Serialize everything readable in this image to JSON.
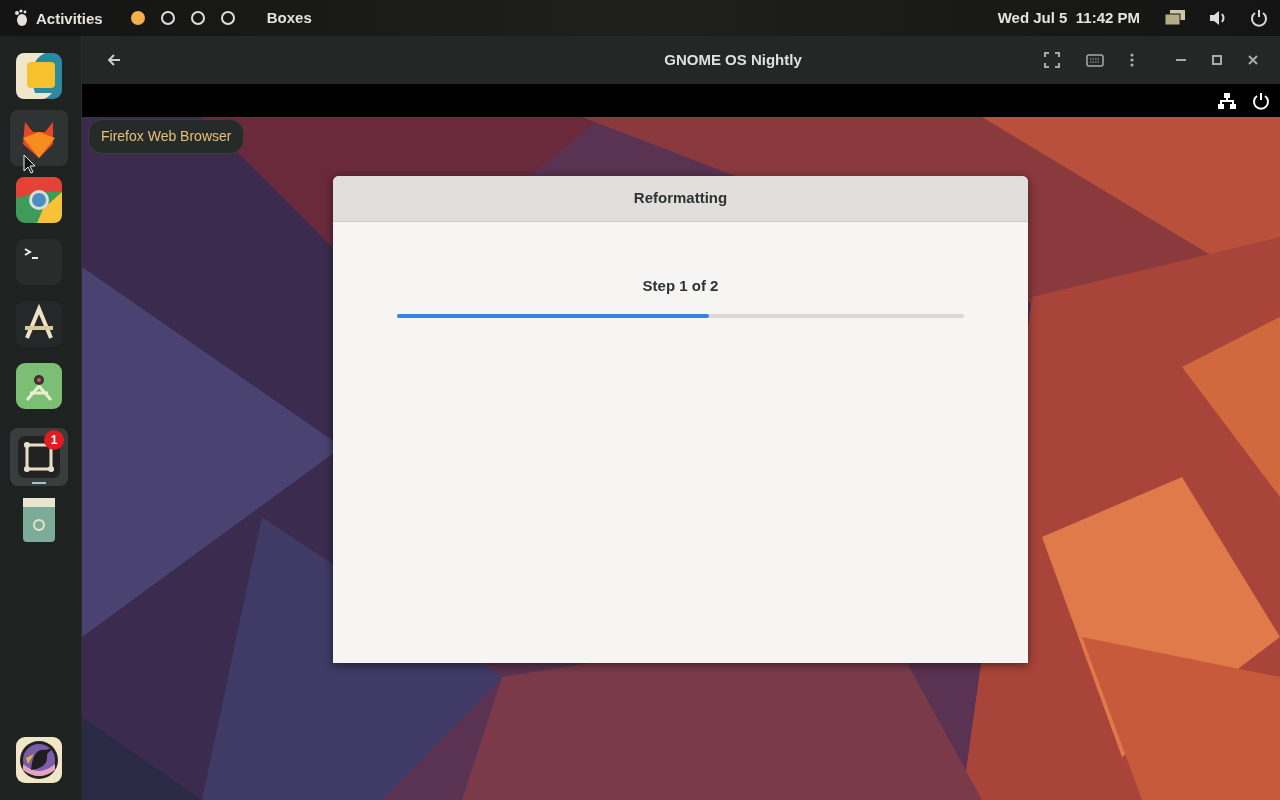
{
  "top_bar": {
    "activities": "Activities",
    "workspaces": [
      {
        "selected": true
      },
      {
        "selected": false
      },
      {
        "selected": false
      },
      {
        "selected": false
      }
    ],
    "app_name": "Boxes",
    "clock": "Wed Jul 5  11:42 PM"
  },
  "dock": {
    "items": [
      {
        "hovered": false,
        "running": false
      },
      {
        "hovered": true,
        "running": false
      },
      {
        "hovered": false,
        "running": false
      },
      {
        "hovered": false,
        "running": false
      },
      {
        "hovered": false,
        "running": false
      },
      {
        "hovered": false,
        "running": false
      },
      {
        "hovered": false,
        "running": true,
        "badge": "1"
      },
      {
        "hovered": false,
        "running": false
      },
      {
        "hovered": false,
        "running": false
      }
    ],
    "tooltip": "Firefox Web Browser"
  },
  "window": {
    "title": "GNOME OS Nightly"
  },
  "dialog": {
    "title": "Reformatting",
    "step": "Step 1 of 2",
    "progress": {
      "level": 0.55
    }
  }
}
